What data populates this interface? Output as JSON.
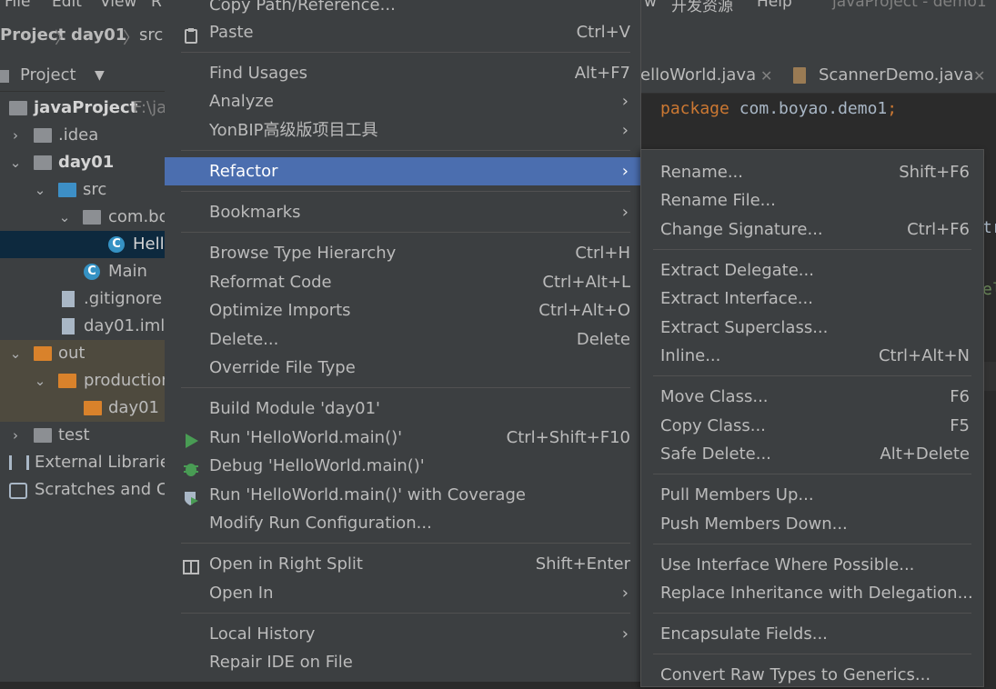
{
  "menubar": {
    "items": [
      "File",
      "Edit",
      "View",
      "R",
      "w",
      "开发资源",
      "Help",
      "javaProject - demo1"
    ]
  },
  "breadcrumb": [
    "Project",
    "day01",
    "src"
  ],
  "project_panel": {
    "title": "Project",
    "tree": [
      {
        "label": "javaProject",
        "hint": "F:\\ja",
        "bold": true
      },
      {
        "label": ".idea"
      },
      {
        "label": "day01",
        "bold": true
      },
      {
        "label": "src"
      },
      {
        "label": "com.bo"
      },
      {
        "label": "Hell"
      },
      {
        "label": "Main"
      },
      {
        "label": ".gitignore"
      },
      {
        "label": "day01.iml"
      },
      {
        "label": "out"
      },
      {
        "label": "production"
      },
      {
        "label": "day01"
      },
      {
        "label": "test"
      },
      {
        "label": "External Libraries"
      },
      {
        "label": "Scratches and Co"
      }
    ]
  },
  "editor": {
    "tabs": [
      "elloWorld.java",
      "ScannerDemo.java"
    ],
    "code_keyword": "package",
    "code_rest": " com.boyao.demo1",
    "code_semicolon": ";",
    "fragment1": "tr",
    "fragment2": "el"
  },
  "context_menu": {
    "items": [
      {
        "label": "Copy Path/Reference..."
      },
      {
        "label": "Paste",
        "shortcut": "Ctrl+V",
        "icon": "clipboard-icon"
      },
      {
        "label": "Find Usages",
        "shortcut": "Alt+F7"
      },
      {
        "label": "Analyze",
        "submenu": true
      },
      {
        "label": "YonBIP高级版项目工具",
        "submenu": true
      },
      {
        "label": "Refactor",
        "submenu": true,
        "selected": true
      },
      {
        "label": "Bookmarks",
        "submenu": true
      },
      {
        "label": "Browse Type Hierarchy",
        "shortcut": "Ctrl+H"
      },
      {
        "label": "Reformat Code",
        "shortcut": "Ctrl+Alt+L"
      },
      {
        "label": "Optimize Imports",
        "shortcut": "Ctrl+Alt+O"
      },
      {
        "label": "Delete...",
        "shortcut": "Delete"
      },
      {
        "label": "Override File Type"
      },
      {
        "label": "Build Module 'day01'"
      },
      {
        "label": "Run 'HelloWorld.main()'",
        "shortcut": "Ctrl+Shift+F10",
        "icon": "run-icon"
      },
      {
        "label": "Debug 'HelloWorld.main()'",
        "icon": "debug-icon"
      },
      {
        "label": "Run 'HelloWorld.main()' with Coverage",
        "icon": "coverage-icon"
      },
      {
        "label": "Modify Run Configuration..."
      },
      {
        "label": "Open in Right Split",
        "shortcut": "Shift+Enter",
        "icon": "split-icon"
      },
      {
        "label": "Open In",
        "submenu": true
      },
      {
        "label": "Local History",
        "submenu": true
      },
      {
        "label": "Repair IDE on File"
      }
    ]
  },
  "refactor_submenu": {
    "items": [
      {
        "label": "Rename...",
        "shortcut": "Shift+F6"
      },
      {
        "label": "Rename File..."
      },
      {
        "label": "Change Signature...",
        "shortcut": "Ctrl+F6"
      },
      {
        "label": "Extract Delegate..."
      },
      {
        "label": "Extract Interface..."
      },
      {
        "label": "Extract Superclass..."
      },
      {
        "label": "Inline...",
        "shortcut": "Ctrl+Alt+N"
      },
      {
        "label": "Move Class...",
        "shortcut": "F6"
      },
      {
        "label": "Copy Class...",
        "shortcut": "F5"
      },
      {
        "label": "Safe Delete...",
        "shortcut": "Alt+Delete"
      },
      {
        "label": "Pull Members Up..."
      },
      {
        "label": "Push Members Down..."
      },
      {
        "label": "Use Interface Where Possible..."
      },
      {
        "label": "Replace Inheritance with Delegation..."
      },
      {
        "label": "Encapsulate Fields..."
      },
      {
        "label": "Convert Raw Types to Generics..."
      }
    ]
  },
  "colors": {
    "menu_bg": "#3c3f41",
    "selection": "#4b6eaf",
    "keyword": "#cc7832",
    "text": "#bbbbbb"
  }
}
